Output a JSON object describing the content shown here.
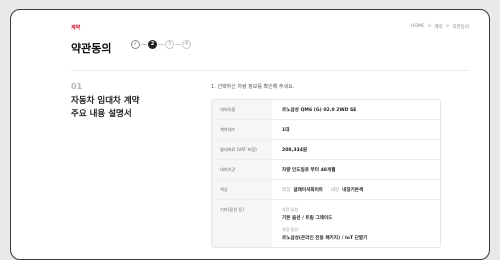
{
  "header": {
    "section_tag": "계약",
    "title": "약관동의",
    "steps": [
      "✓",
      "2",
      "3",
      "4"
    ],
    "breadcrumb": [
      "HOME",
      ">",
      "계약",
      ">",
      "약관동의"
    ]
  },
  "section": {
    "number": "01",
    "title_line1": "자동차 임대차 계약",
    "title_line2": "주요 내용 설명서"
  },
  "intro": "1. 선택하신 차량 정보를 확인해 주세요.",
  "rows": [
    {
      "label": "대여차종",
      "value": "르노삼성 QM6 (G) 02.0 2WD SE"
    },
    {
      "label": "계약대수",
      "value": "1대"
    },
    {
      "label": "월대여료 (VAT 포함)",
      "value": "208,334원"
    },
    {
      "label": "대여기간",
      "value": "차량 인도일로 부터 48개월"
    }
  ],
  "color_row": {
    "label": "색상",
    "ext_caption": "외장",
    "ext_value": "글레이셔화이트",
    "int_caption": "내장",
    "int_value": "내장기본색"
  },
  "options_row": {
    "label": "기타(옵션 등)",
    "cap1": "차량 옵션",
    "val1": "기본 옵션 / 트림 그레이드",
    "cap2": "차량 옵션",
    "val2": "르노삼성(온라인 전용 패키지) / IoT 단말기"
  },
  "colors": {
    "accent": "#c8102e"
  }
}
